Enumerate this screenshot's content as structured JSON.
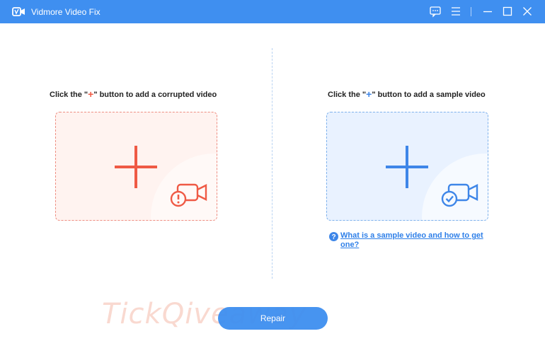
{
  "app": {
    "title": "Vidmore Video Fix",
    "accent_color": "#3f8ff0"
  },
  "titlebar": {
    "icons": [
      "feedback-icon",
      "menu-icon",
      "minimize-icon",
      "maximize-icon",
      "close-icon"
    ]
  },
  "left_panel": {
    "hint_before": "Click the \"",
    "hint_plus": "+",
    "hint_after": "\" button to add a corrupted video",
    "accent_color": "#ef5a45",
    "icons": [
      "add-plus-icon",
      "corrupted-video-camera-icon"
    ]
  },
  "right_panel": {
    "hint_before": "Click the \"",
    "hint_plus": "+",
    "hint_after": "\" button to add a sample video",
    "accent_color": "#3e86e8",
    "icons": [
      "add-plus-icon",
      "sample-video-camera-icon"
    ],
    "help_link": "What is a sample video and how to get one?"
  },
  "watermark": "TickQiveaway",
  "footer": {
    "repair_label": "Repair"
  }
}
